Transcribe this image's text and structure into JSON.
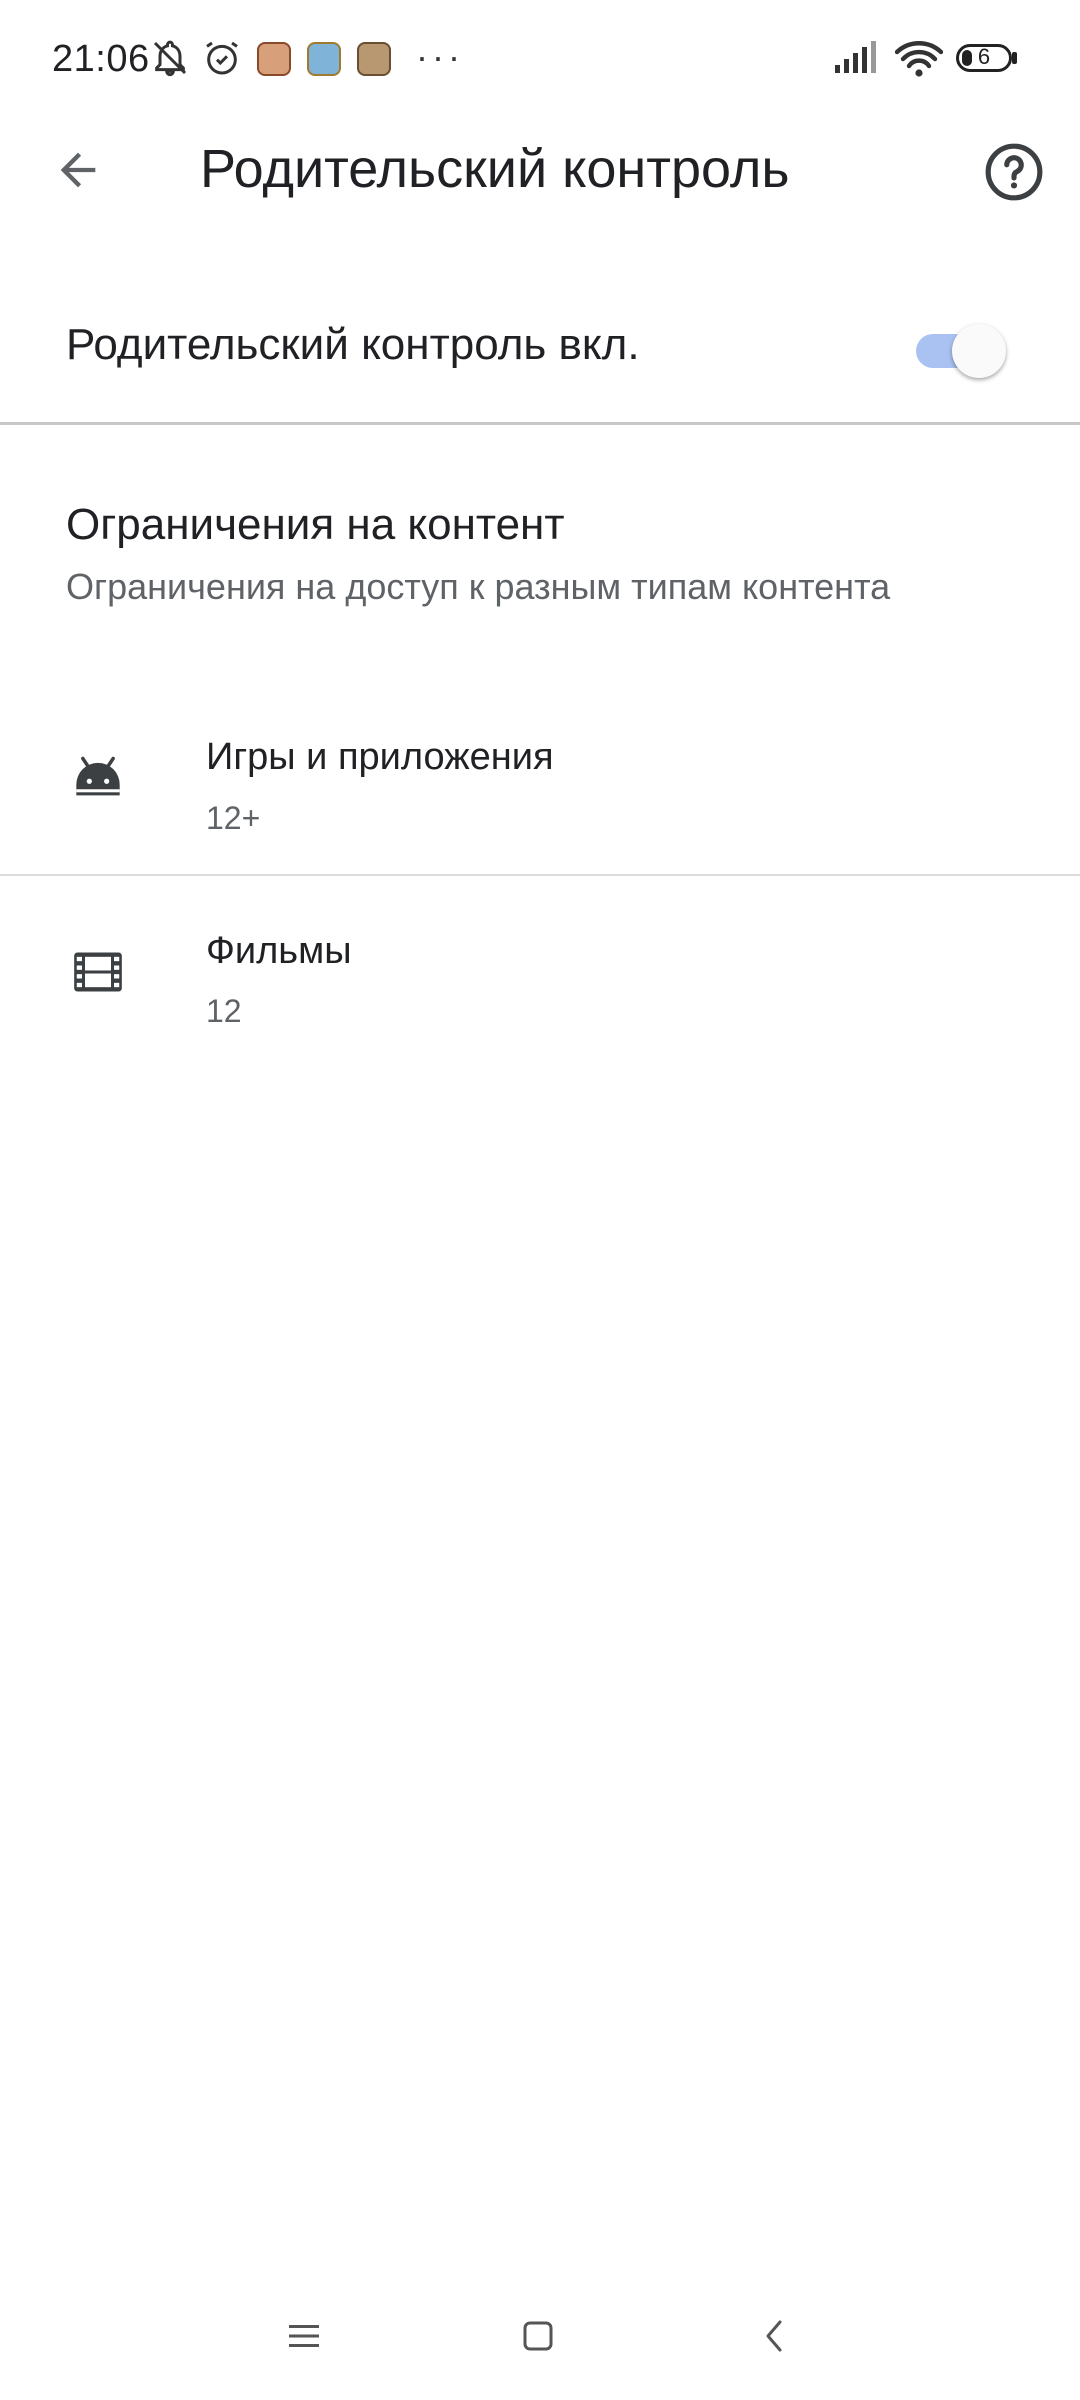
{
  "status_bar": {
    "time": "21:06",
    "icons": [
      "notifications-off-icon",
      "alarm-icon",
      "app-notification-1",
      "app-notification-2",
      "app-notification-3"
    ],
    "more": "···",
    "battery_level": "6"
  },
  "app_bar": {
    "title": "Родительский контроль",
    "back_icon": "arrow-back-icon",
    "help_icon": "help-circle-icon"
  },
  "master_toggle": {
    "label": "Родительский контроль вкл.",
    "state": "on",
    "accent_color": "#a9c2f2"
  },
  "content_restrictions": {
    "title": "Ограничения на контент",
    "subtitle": "Ограничения на доступ к разным типам контента"
  },
  "items": [
    {
      "icon": "android-icon",
      "title": "Игры и приложения",
      "rating": "12+"
    },
    {
      "icon": "film-icon",
      "title": "Фильмы",
      "rating": "12"
    }
  ],
  "nav_bar": {
    "buttons": [
      "menu-icon",
      "home-icon",
      "back-icon"
    ]
  }
}
